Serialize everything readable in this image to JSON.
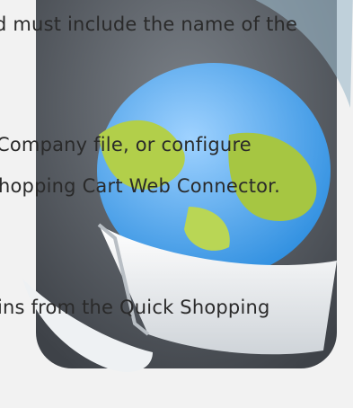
{
  "background_icon": {
    "name": "globe-basket-icon",
    "colors": {
      "frame": "#5a5f66",
      "globe": "#58a8e8",
      "land": "#b2cf4a",
      "basket": "#e9ecef"
    }
  },
  "text": {
    "line1": "d must include the name of the",
    "line2": "Company file, or configure",
    "line3": "hopping Cart Web Connector.",
    "line4": "ins from the Quick Shopping"
  }
}
